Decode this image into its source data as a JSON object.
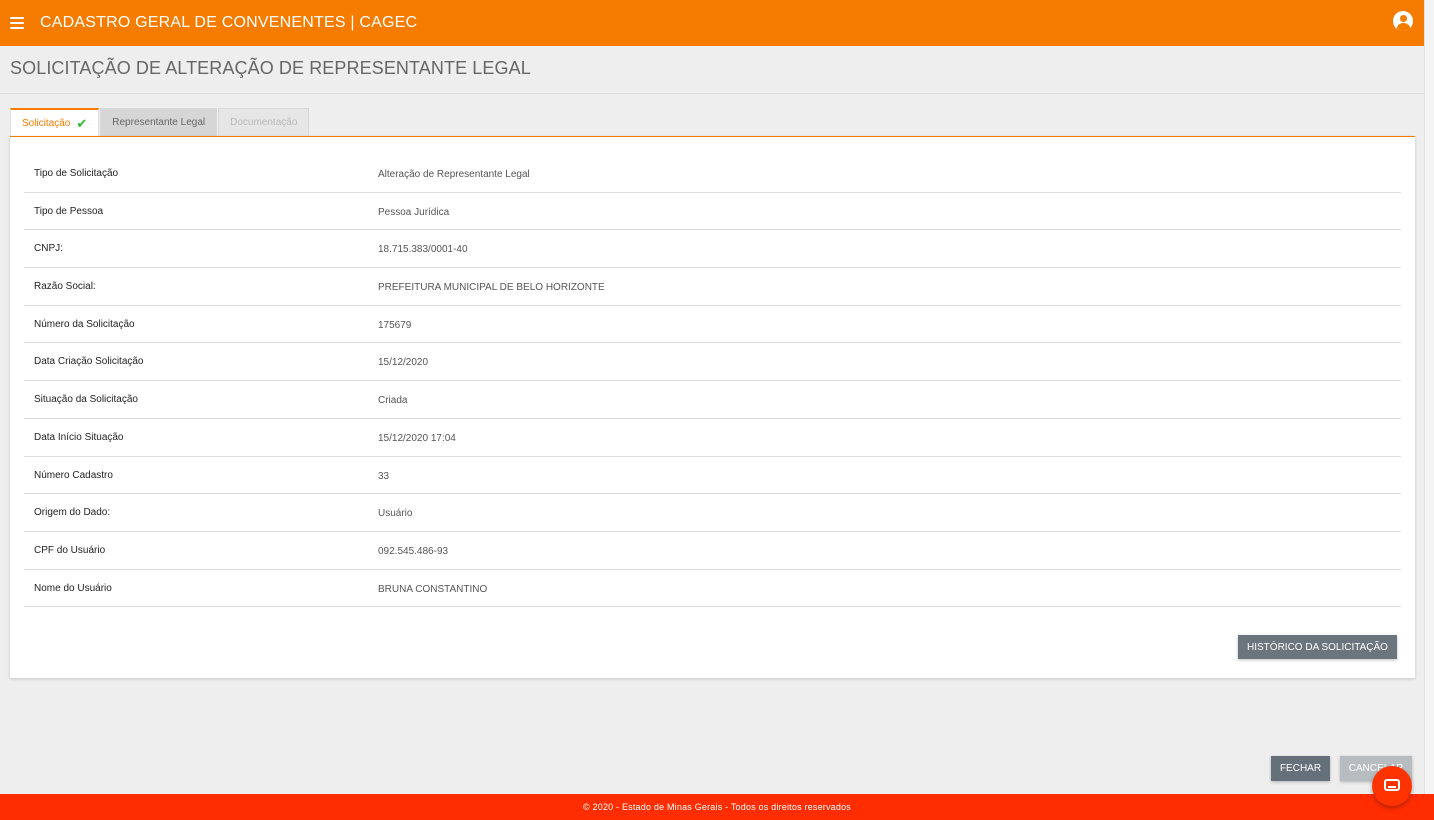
{
  "header": {
    "title": "CADASTRO GERAL DE CONVENENTES | CAGEC"
  },
  "page": {
    "title": "SOLICITAÇÃO DE ALTERAÇÃO DE REPRESENTANTE LEGAL"
  },
  "tabs": [
    {
      "label": "Solicitação",
      "state": "active-completed"
    },
    {
      "label": "Representante Legal",
      "state": "inactive"
    },
    {
      "label": "Documentação",
      "state": "disabled"
    }
  ],
  "details": [
    {
      "label": "Tipo de Solicitação",
      "value": "Alteração de Representante Legal"
    },
    {
      "label": "Tipo de Pessoa",
      "value": "Pessoa Jurídica"
    },
    {
      "label": "CNPJ:",
      "value": "18.715.383/0001-40"
    },
    {
      "label": "Razão Social:",
      "value": "PREFEITURA MUNICIPAL DE BELO HORIZONTE"
    },
    {
      "label": "Número da Solicitação",
      "value": "175679"
    },
    {
      "label": "Data Criação Solicitação",
      "value": "15/12/2020"
    },
    {
      "label": "Situação da Solicitação",
      "value": "Criada"
    },
    {
      "label": "Data Início Situação",
      "value": "15/12/2020 17:04"
    },
    {
      "label": "Número Cadastro",
      "value": "33"
    },
    {
      "label": "Origem do Dado:",
      "value": "Usuário"
    },
    {
      "label": "CPF do Usuário",
      "value": "092.545.486-93"
    },
    {
      "label": "Nome do Usuário",
      "value": "BRUNA CONSTANTINO"
    }
  ],
  "buttons": {
    "historico": "HISTÓRICO DA SOLICITAÇÃO",
    "fechar": "FECHAR",
    "cancelar": "CANCELAR"
  },
  "footer": {
    "text": "© 2020 - Estado de Minas Gerais - Todos os direitos reservados"
  },
  "icons": {
    "menu": "hamburger-menu-icon",
    "user": "user-account-icon",
    "check": "check-icon",
    "chat": "chat-icon"
  },
  "colors": {
    "primary": "#f57c00",
    "footer": "#ff2d00",
    "check": "#2eb82e",
    "button": "#6c757d"
  }
}
